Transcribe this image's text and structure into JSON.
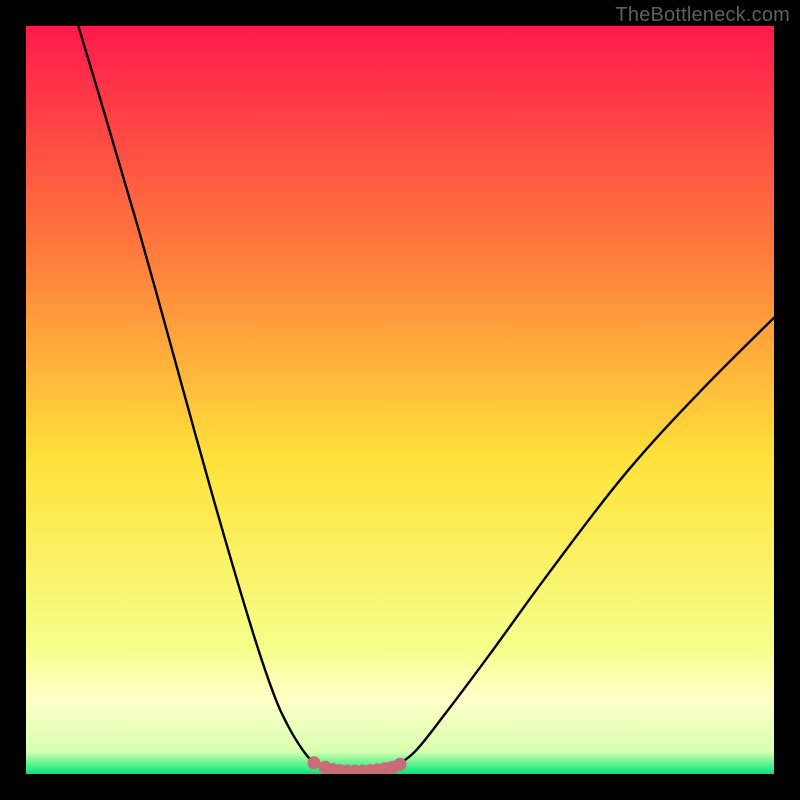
{
  "watermark": "TheBottleneck.com",
  "chart_data": {
    "type": "line",
    "title": "",
    "xlabel": "",
    "ylabel": "",
    "xlim": [
      0,
      100
    ],
    "ylim": [
      0,
      100
    ],
    "grid": false,
    "legend": false,
    "background_gradient": {
      "top_color": "#ff1a4c",
      "upper_mid_color": "#ff7a3c",
      "mid_color": "#ffe23a",
      "lower_mid_color": "#f6ff8a",
      "band_color": "#ffffc8",
      "bottom_color": "#00e676"
    },
    "series": [
      {
        "name": "left-branch",
        "x": [
          7,
          10,
          15,
          20,
          25,
          30,
          33,
          35,
          37,
          38.5,
          40
        ],
        "y": [
          100,
          90,
          73,
          55,
          37,
          20,
          11,
          6.5,
          3.2,
          1.5,
          0.8
        ]
      },
      {
        "name": "right-branch",
        "x": [
          49,
          52,
          56,
          62,
          70,
          80,
          90,
          100
        ],
        "y": [
          0.8,
          3,
          8,
          16,
          27,
          40,
          51,
          61
        ]
      },
      {
        "name": "trough",
        "x": [
          40,
          41,
          42,
          43,
          44,
          45,
          46,
          47,
          48,
          49
        ],
        "y": [
          0.8,
          0.5,
          0.4,
          0.35,
          0.35,
          0.35,
          0.4,
          0.5,
          0.6,
          0.8
        ]
      }
    ],
    "trough_markers": {
      "name": "optimal-range-dots",
      "color": "#cc6b77",
      "points": [
        {
          "x": 38.5,
          "y": 1.5
        },
        {
          "x": 40,
          "y": 0.9
        },
        {
          "x": 41,
          "y": 0.6
        },
        {
          "x": 42,
          "y": 0.45
        },
        {
          "x": 43,
          "y": 0.4
        },
        {
          "x": 44,
          "y": 0.4
        },
        {
          "x": 45,
          "y": 0.4
        },
        {
          "x": 46,
          "y": 0.45
        },
        {
          "x": 47,
          "y": 0.55
        },
        {
          "x": 48,
          "y": 0.7
        },
        {
          "x": 49,
          "y": 0.9
        },
        {
          "x": 50,
          "y": 1.3
        }
      ]
    }
  }
}
